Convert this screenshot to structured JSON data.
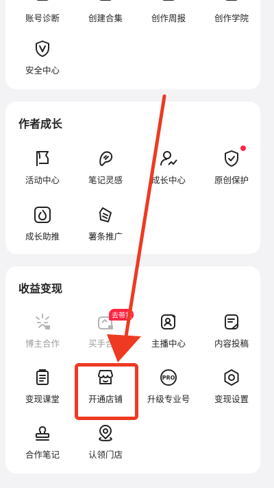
{
  "card1": {
    "items": [
      {
        "label": "账号诊断",
        "icon": "account-diagnosis-icon"
      },
      {
        "label": "创建合集",
        "icon": "create-collection-icon"
      },
      {
        "label": "创作周报",
        "icon": "creation-weekly-report-icon"
      },
      {
        "label": "创作学院",
        "icon": "creation-academy-icon"
      },
      {
        "label": "安全中心",
        "icon": "shield-icon"
      }
    ]
  },
  "card2": {
    "title": "作者成长",
    "items": [
      {
        "label": "活动中心",
        "icon": "flag-icon"
      },
      {
        "label": "笔记灵感",
        "icon": "lightbulb-icon"
      },
      {
        "label": "成长中心",
        "icon": "user-growth-icon"
      },
      {
        "label": "原创保护",
        "icon": "shield-check-icon"
      },
      {
        "label": "成长助推",
        "icon": "flame-icon"
      },
      {
        "label": "薯条推广",
        "icon": "fries-icon"
      }
    ]
  },
  "card3": {
    "title": "收益变现",
    "tag": "去带货",
    "items": [
      {
        "label": "博主合作",
        "icon": "sparkle-icon",
        "disabled": true
      },
      {
        "label": "买手合作",
        "icon": "buyer-icon",
        "disabled": true
      },
      {
        "label": "主播中心",
        "icon": "streamer-icon"
      },
      {
        "label": "内容投稿",
        "icon": "content-submit-icon"
      },
      {
        "label": "变现课堂",
        "icon": "course-icon"
      },
      {
        "label": "开通店铺",
        "icon": "store-icon"
      },
      {
        "label": "升级专业号",
        "icon": "pro-icon",
        "pro_text": "PRO"
      },
      {
        "label": "变现设置",
        "icon": "gear-icon"
      },
      {
        "label": "合作笔记",
        "icon": "stamp-icon"
      },
      {
        "label": "认领门店",
        "icon": "location-icon"
      }
    ]
  },
  "colors": {
    "accent": "#ff2442",
    "annotation": "#ee3a22",
    "disabled": "#9b9b9b"
  }
}
